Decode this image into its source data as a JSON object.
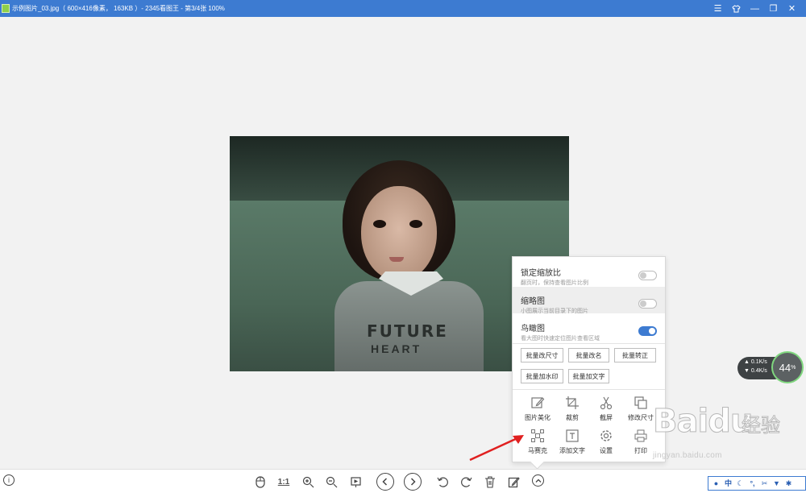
{
  "window": {
    "title": "示例图片_03.jpg（ 600×416像素， 163KB ）- 2345看图王 - 第3/4张 100%"
  },
  "menu": {
    "options": [
      {
        "title": "锁定缩放比",
        "desc": "翻页时，保持查看图片比例",
        "enabled": false
      },
      {
        "title": "缩略图",
        "desc": "小图展示当前目录下的图片",
        "enabled": false
      },
      {
        "title": "鸟瞰图",
        "desc": "看大图时快速定位图片查看区域",
        "enabled": true
      }
    ],
    "batch_buttons": [
      "批量改尺寸",
      "批量改名",
      "批量转正",
      "批量加水印",
      "批量加文字"
    ],
    "tools": [
      {
        "label": "图片美化",
        "icon": "edit-icon"
      },
      {
        "label": "裁剪",
        "icon": "crop-icon"
      },
      {
        "label": "截屏",
        "icon": "scissors-icon"
      },
      {
        "label": "修改尺寸",
        "icon": "resize-icon"
      },
      {
        "label": "马赛克",
        "icon": "mosaic-icon"
      },
      {
        "label": "添加文字",
        "icon": "text-icon"
      },
      {
        "label": "设置",
        "icon": "gear-icon"
      },
      {
        "label": "打印",
        "icon": "print-icon"
      }
    ]
  },
  "speed_widget": {
    "upload": "0.1K/s",
    "download": "0.4K/s",
    "percent": "44",
    "percent_unit": "%"
  },
  "toolbar": {
    "actual_size_label": "1:1"
  },
  "watermark": {
    "logo": "Baidu",
    "logo_cn": "经验",
    "url": "jingyan.baidu.com"
  },
  "photo": {
    "shirt_text_1": "FUTURE",
    "shirt_text_2": "HEART"
  },
  "tray": {
    "ime_label": "中"
  }
}
